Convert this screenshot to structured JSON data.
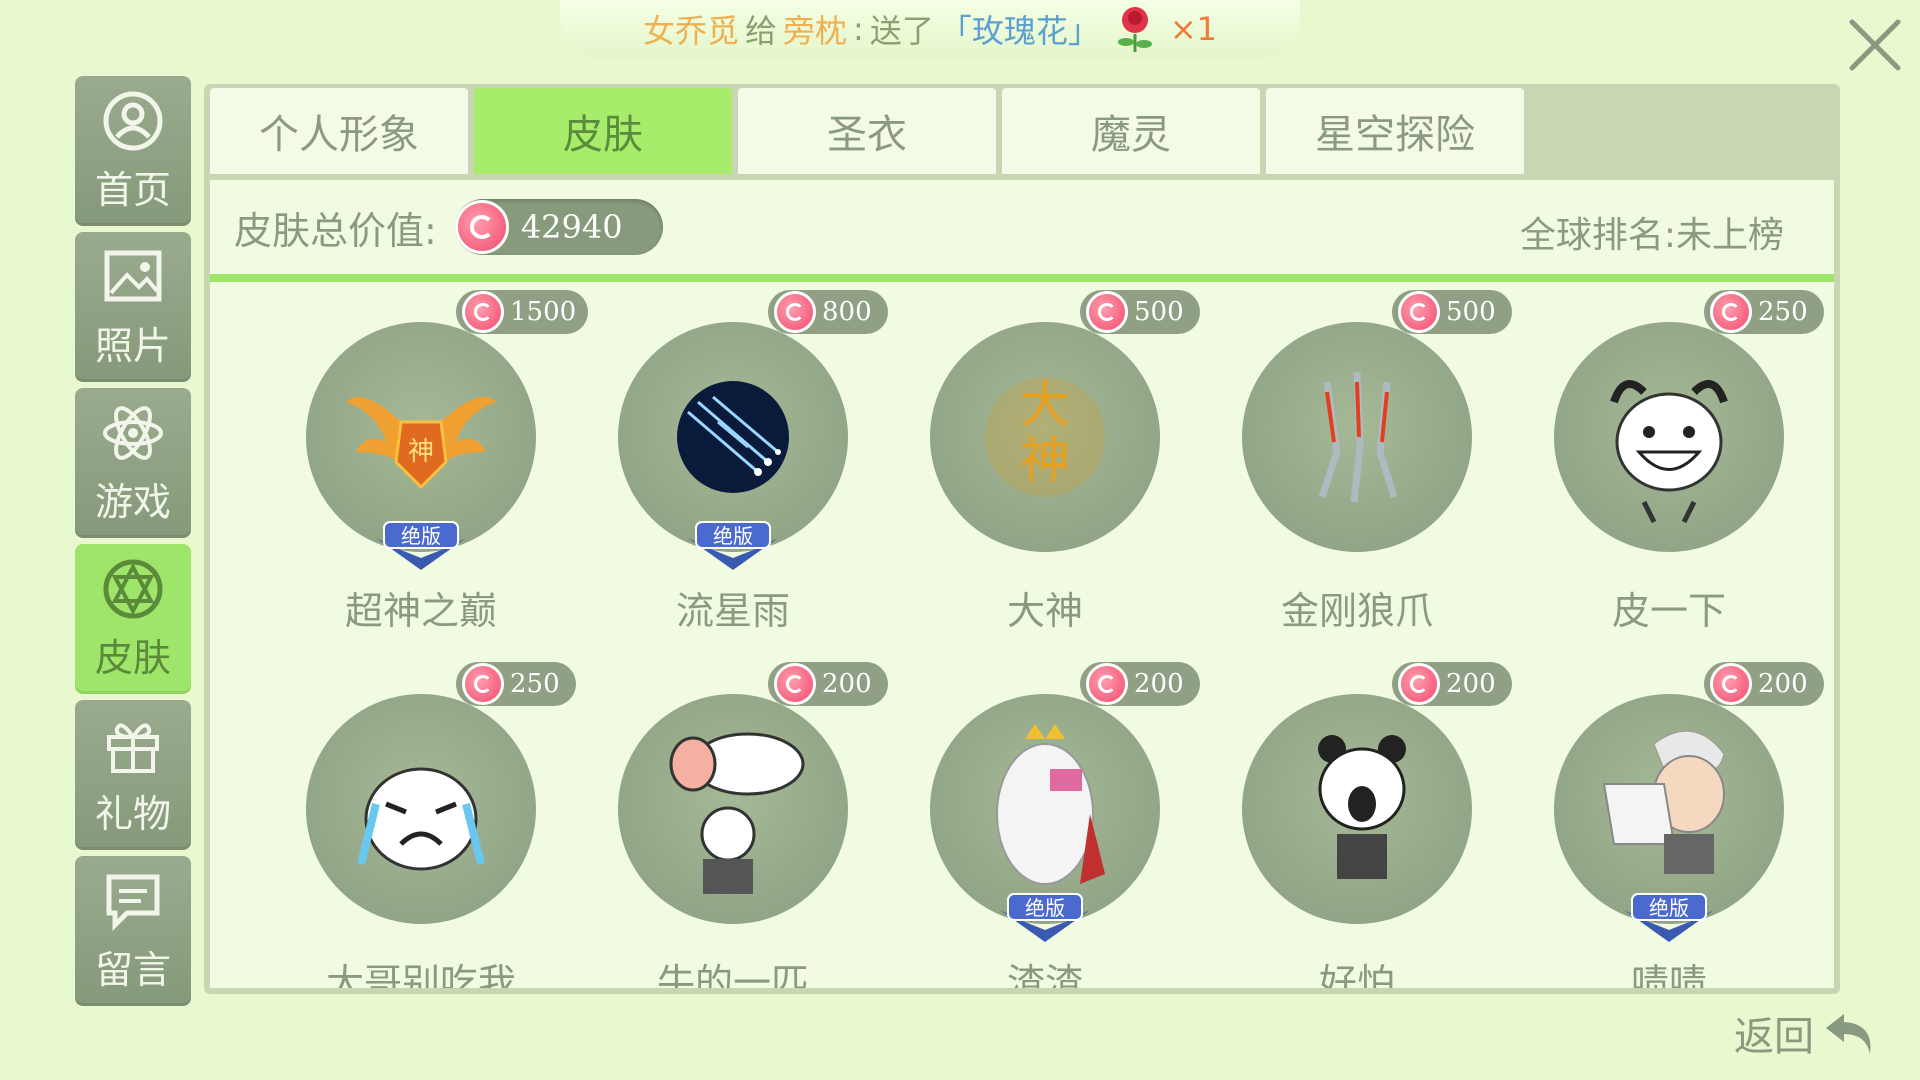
{
  "notice": {
    "sender": "女乔觅",
    "mid": "给",
    "receiver": "旁枕",
    "colon": ":",
    "action": "送了",
    "gift": "「玫瑰花」",
    "count": "×1"
  },
  "sidebar": {
    "items": [
      {
        "label": "首页",
        "icon": "user-icon",
        "active": false
      },
      {
        "label": "照片",
        "icon": "photo-icon",
        "active": false
      },
      {
        "label": "游戏",
        "icon": "atom-icon",
        "active": false
      },
      {
        "label": "皮肤",
        "icon": "skin-icon",
        "active": true
      },
      {
        "label": "礼物",
        "icon": "gift-icon",
        "active": false
      },
      {
        "label": "留言",
        "icon": "message-icon",
        "active": false
      }
    ]
  },
  "tabs": [
    {
      "label": "个人形象",
      "active": false
    },
    {
      "label": "皮肤",
      "active": true
    },
    {
      "label": "圣衣",
      "active": false
    },
    {
      "label": "魔灵",
      "active": false
    },
    {
      "label": "星空探险",
      "active": false
    }
  ],
  "summary": {
    "label": "皮肤总价值:",
    "value": "42940",
    "rank": "全球排名:未上榜"
  },
  "skins": [
    {
      "name": "超神之巅",
      "price": "1500",
      "badge": "绝版",
      "art": "winged-emblem-icon"
    },
    {
      "name": "流星雨",
      "price": "800",
      "badge": "绝版",
      "art": "meteor-icon"
    },
    {
      "name": "大神",
      "price": "500",
      "badge": "",
      "art": "da-shen-text-icon"
    },
    {
      "name": "金刚狼爪",
      "price": "500",
      "badge": "",
      "art": "claw-icon"
    },
    {
      "name": "皮一下",
      "price": "250",
      "badge": "",
      "art": "grin-face-icon"
    },
    {
      "name": "大哥别吃我",
      "price": "250",
      "badge": "",
      "art": "crying-face-icon"
    },
    {
      "name": "牛的一匹",
      "price": "200",
      "badge": "",
      "art": "cow-panda-icon"
    },
    {
      "name": "渣渣",
      "price": "200",
      "badge": "绝版",
      "art": "zhazha-face-icon"
    },
    {
      "name": "好怕",
      "price": "200",
      "badge": "",
      "art": "scared-panda-icon"
    },
    {
      "name": "啧啧",
      "price": "200",
      "badge": "绝版",
      "art": "old-man-face-icon"
    }
  ],
  "back_label": "返回",
  "colors": {
    "accent": "#9ee56a",
    "panel": "#f0fbe2",
    "sidebar": "#8fa085",
    "coin": "#f04a6a",
    "gift_text": "#5aa0d0"
  }
}
